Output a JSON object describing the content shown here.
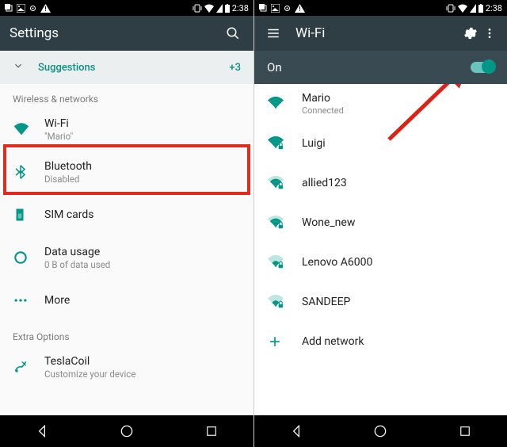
{
  "status": {
    "time": "2:38"
  },
  "left": {
    "title": "Settings",
    "suggestions": {
      "label": "Suggestions",
      "count": "+3"
    },
    "section_wireless": "Wireless & networks",
    "rows": {
      "wifi": {
        "title": "Wi-Fi",
        "sub": "\"Mario\""
      },
      "bt": {
        "title": "Bluetooth",
        "sub": "Disabled"
      },
      "sim": {
        "title": "SIM cards"
      },
      "data": {
        "title": "Data usage",
        "sub": "0 B of data used"
      },
      "more": {
        "title": "More"
      }
    },
    "section_extra": "Extra Options",
    "tesla": {
      "title": "TeslaCoil",
      "sub": "Customize your device"
    }
  },
  "right": {
    "title": "Wi-Fi",
    "on_label": "On",
    "networks": [
      {
        "ssid": "Mario",
        "sub": "Connected",
        "strength": 4,
        "lock": false
      },
      {
        "ssid": "Luigi",
        "strength": 4,
        "lock": true
      },
      {
        "ssid": "allied123",
        "strength": 3,
        "lock": true
      },
      {
        "ssid": "Wone_new",
        "strength": 3,
        "lock": true
      },
      {
        "ssid": "Lenovo A6000",
        "strength": 2,
        "lock": true
      },
      {
        "ssid": "SANDEEP",
        "strength": 2,
        "lock": true
      }
    ],
    "add": "Add network"
  },
  "colors": {
    "teal": "#009688",
    "appbar": "#2f3e45",
    "highlight": "#e02b1e"
  }
}
